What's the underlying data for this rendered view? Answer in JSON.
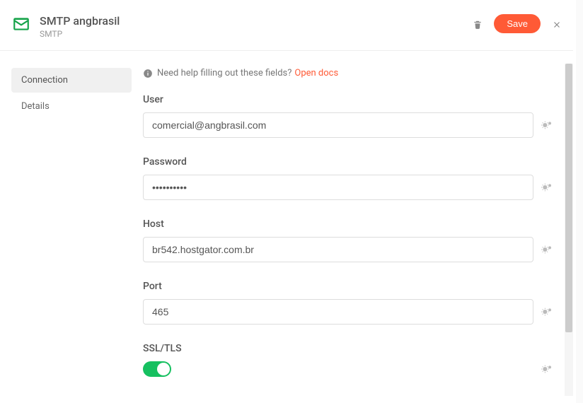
{
  "header": {
    "title": "SMTP angbrasil",
    "subtitle": "SMTP",
    "save_label": "Save"
  },
  "sidebar": {
    "items": [
      {
        "label": "Connection",
        "active": true
      },
      {
        "label": "Details",
        "active": false
      }
    ]
  },
  "help": {
    "text": "Need help filling out these fields?",
    "link": "Open docs"
  },
  "fields": {
    "user": {
      "label": "User",
      "value": "comercial@angbrasil.com"
    },
    "password": {
      "label": "Password",
      "value": "••••••••••"
    },
    "host": {
      "label": "Host",
      "value": "br542.hostgator.com.br"
    },
    "port": {
      "label": "Port",
      "value": "465"
    },
    "ssltls": {
      "label": "SSL/TLS",
      "value": true
    }
  }
}
